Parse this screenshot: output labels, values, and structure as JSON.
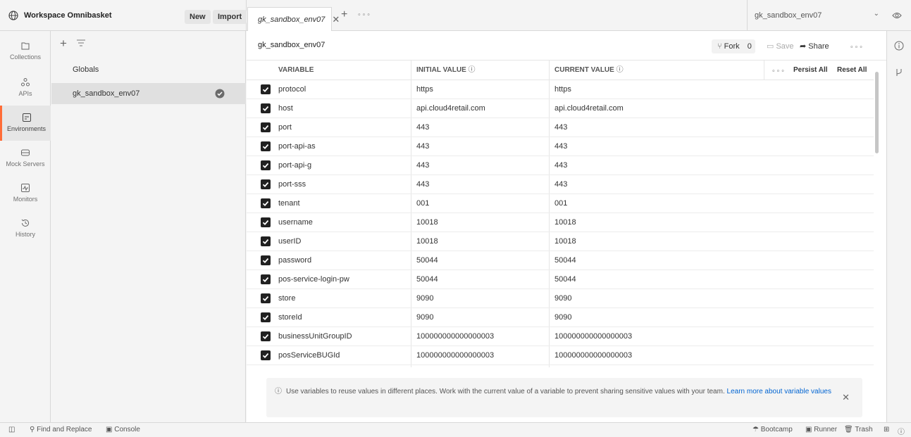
{
  "workspace": {
    "title": "Workspace Omnibasket",
    "new_label": "New",
    "import_label": "Import"
  },
  "tabs": [
    {
      "label": "gk_sandbox_env07"
    }
  ],
  "env_selector": {
    "value": "gk_sandbox_env07"
  },
  "nav": [
    {
      "label": "Collections",
      "icon": "collections-icon"
    },
    {
      "label": "APIs",
      "icon": "apis-icon"
    },
    {
      "label": "Environments",
      "icon": "environments-icon"
    },
    {
      "label": "Mock Servers",
      "icon": "mock-servers-icon"
    },
    {
      "label": "Monitors",
      "icon": "monitors-icon"
    },
    {
      "label": "History",
      "icon": "history-icon"
    }
  ],
  "env_list": {
    "globals": "Globals",
    "selected": "gk_sandbox_env07"
  },
  "editor": {
    "name": "gk_sandbox_env07",
    "fork_label": "Fork",
    "fork_count": "0",
    "save_label": "Save",
    "share_label": "Share",
    "persist_all": "Persist All",
    "reset_all": "Reset All"
  },
  "table": {
    "headers": {
      "variable": "VARIABLE",
      "initial": "INITIAL VALUE",
      "current": "CURRENT VALUE"
    },
    "rows": [
      {
        "variable": "protocol",
        "initial": "https",
        "current": "https"
      },
      {
        "variable": "host",
        "initial": "api.cloud4retail.com",
        "current": "api.cloud4retail.com"
      },
      {
        "variable": "port",
        "initial": "443",
        "current": "443"
      },
      {
        "variable": "port-api-as",
        "initial": "443",
        "current": "443"
      },
      {
        "variable": "port-api-g",
        "initial": "443",
        "current": "443"
      },
      {
        "variable": "port-sss",
        "initial": "443",
        "current": "443"
      },
      {
        "variable": "tenant",
        "initial": "001",
        "current": "001"
      },
      {
        "variable": "username",
        "initial": "10018",
        "current": "10018"
      },
      {
        "variable": "userID",
        "initial": "10018",
        "current": "10018"
      },
      {
        "variable": "password",
        "initial": "50044",
        "current": "50044"
      },
      {
        "variable": "pos-service-login-pw",
        "initial": "50044",
        "current": "50044"
      },
      {
        "variable": "store",
        "initial": "9090",
        "current": "9090"
      },
      {
        "variable": "storeId",
        "initial": "9090",
        "current": "9090"
      },
      {
        "variable": "businessUnitGroupID",
        "initial": "100000000000000003",
        "current": "100000000000000003"
      },
      {
        "variable": "posServiceBUGId",
        "initial": "100000000000000003",
        "current": "100000000000000003"
      }
    ]
  },
  "info": {
    "text": "Use variables to reuse values in different places. Work with the current value of a variable to prevent sharing sensitive values with your team.",
    "link": "Learn more about variable values"
  },
  "bottom": {
    "find_replace": "Find and Replace",
    "console": "Console",
    "bootcamp": "Bootcamp",
    "runner": "Runner",
    "trash": "Trash"
  }
}
